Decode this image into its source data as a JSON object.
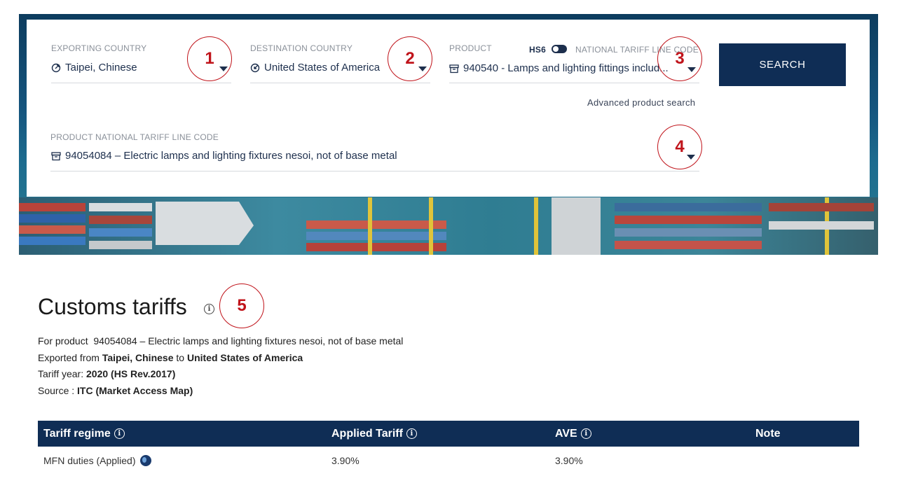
{
  "search": {
    "exporting": {
      "label": "EXPORTING COUNTRY",
      "value": "Taipei, Chinese",
      "icon": "export-icon"
    },
    "destination": {
      "label": "DESTINATION COUNTRY",
      "value": "United States of America",
      "icon": "import-icon"
    },
    "product": {
      "label": "PRODUCT",
      "toggle_left": "HS6",
      "toggle_right": "NATIONAL TARIFF LINE CODE",
      "value": "940540 - Lamps and lighting fittings includ...",
      "icon": "box-icon"
    },
    "button": "SEARCH",
    "advanced_link": "Advanced product search",
    "ntl": {
      "label": "PRODUCT NATIONAL TARIFF LINE CODE",
      "value": "94054084 – Electric lamps and lighting fixtures nesoi, not of base metal",
      "icon": "box-icon"
    }
  },
  "markers": [
    "1",
    "2",
    "3",
    "4",
    "5"
  ],
  "results": {
    "title": "Customs tariffs",
    "info_glyph": "i",
    "product_prefix": "For product",
    "product": "94054084 – Electric lamps and lighting fixtures nesoi, not of base metal",
    "exported_prefix": "Exported from",
    "from": "Taipei, Chinese",
    "to_word": "to",
    "to": "United States of America",
    "year_prefix": "Tariff year:",
    "year": "2020 (HS Rev.2017)",
    "source_prefix": "Source :",
    "source": "ITC (Market Access Map)"
  },
  "table": {
    "headers": [
      "Tariff regime",
      "Applied Tariff",
      "AVE",
      "Note"
    ],
    "rows": [
      {
        "regime": "MFN duties (Applied)",
        "applied": "3.90%",
        "ave": "3.90%",
        "note": ""
      }
    ]
  },
  "colors": {
    "navy": "#0f2d55",
    "marker_red": "#c0141b",
    "hero_blue": "#15557e"
  }
}
